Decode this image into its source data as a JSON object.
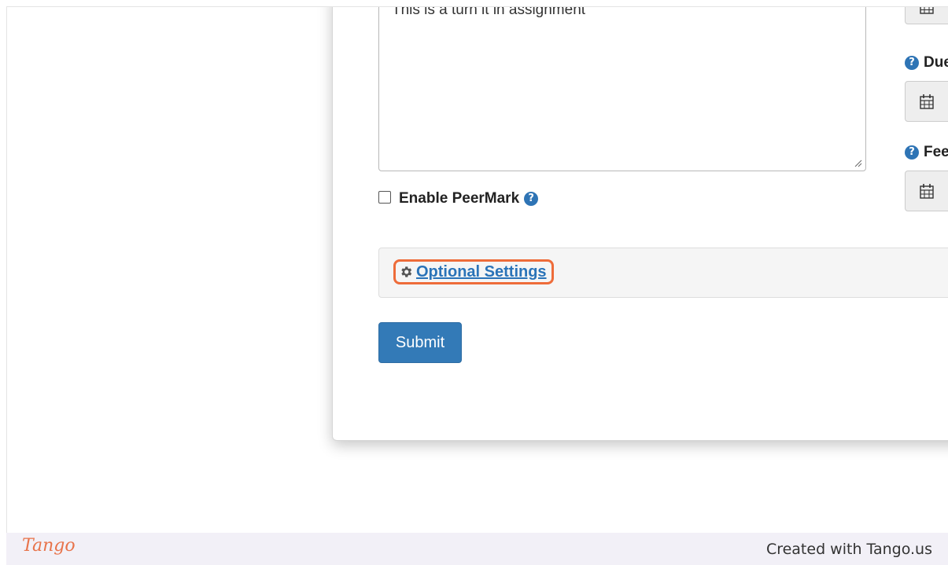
{
  "form": {
    "instructions_value": "This is a turn it in assignment",
    "peermark_label": "Enable PeerMark",
    "optional_settings_label": " Optional Settings",
    "submit_label": "Submit"
  },
  "side_panel": {
    "due_label": "Due",
    "feedback_label": "Fee"
  },
  "footer": {
    "logo_text": "Tango",
    "created_text": "Created with Tango.us"
  },
  "colors": {
    "accent_blue": "#337ab7",
    "highlight_orange": "#ee6c3a",
    "help_icon_blue": "#2e74b5"
  },
  "icons": [
    "question-circle-icon",
    "gear-icon",
    "calendar-icon"
  ]
}
